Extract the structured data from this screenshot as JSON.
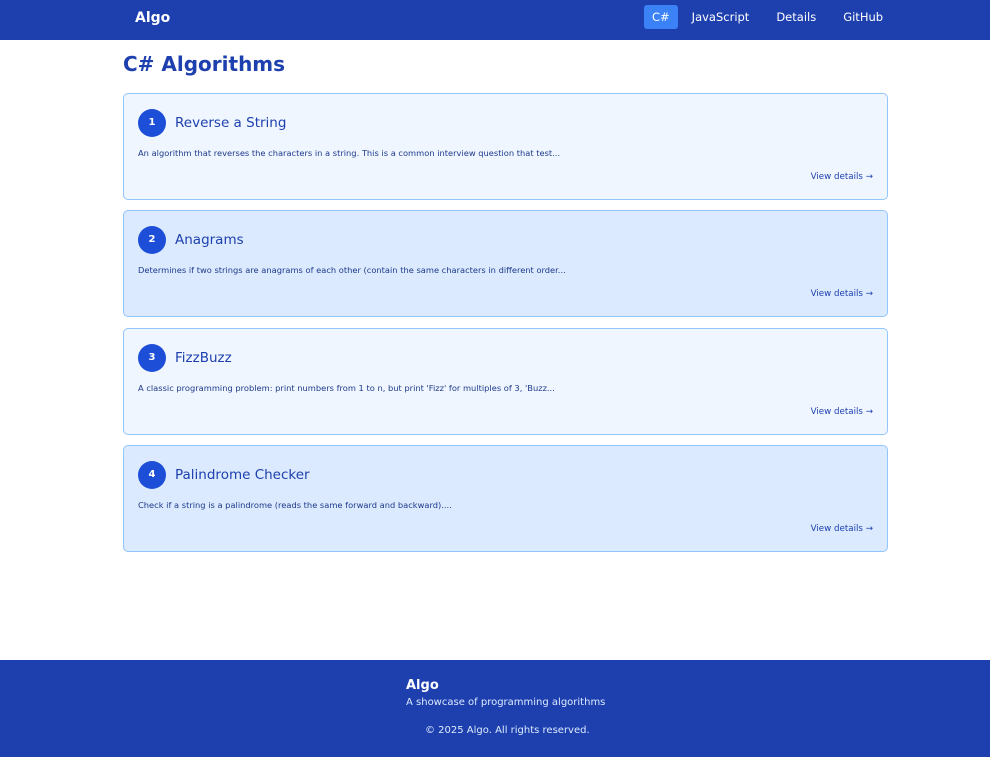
{
  "navbar": {
    "brand": "Algo",
    "links": [
      {
        "label": "C#",
        "active": true
      },
      {
        "label": "JavaScript",
        "active": false
      },
      {
        "label": "Details",
        "active": false
      },
      {
        "label": "GitHub",
        "active": false
      }
    ]
  },
  "main": {
    "title": "C# Algorithms",
    "cards": [
      {
        "number": "1",
        "title": "Reverse a String",
        "description": "An algorithm that reverses the characters in a string. This is a common interview question that test...",
        "link": "View details →"
      },
      {
        "number": "2",
        "title": "Anagrams",
        "description": "Determines if two strings are anagrams of each other (contain the same characters in different order...",
        "link": "View details →"
      },
      {
        "number": "3",
        "title": "FizzBuzz",
        "description": "A classic programming problem: print numbers from 1 to n, but print 'Fizz' for multiples of 3, 'Buzz...",
        "link": "View details →"
      },
      {
        "number": "4",
        "title": "Palindrome Checker",
        "description": "Check if a string is a palindrome (reads the same forward and backward)....",
        "link": "View details →"
      }
    ]
  },
  "footer": {
    "brand": "Algo",
    "tagline": "A showcase of programming algorithms",
    "copyright": "© 2025 Algo. All rights reserved."
  },
  "colors": {
    "nav_bg": "#1e40af",
    "active_tab": "#3b82f6",
    "card_light": "#eff6ff",
    "card_alt": "#dbeafe",
    "badge": "#1d4ed8"
  }
}
